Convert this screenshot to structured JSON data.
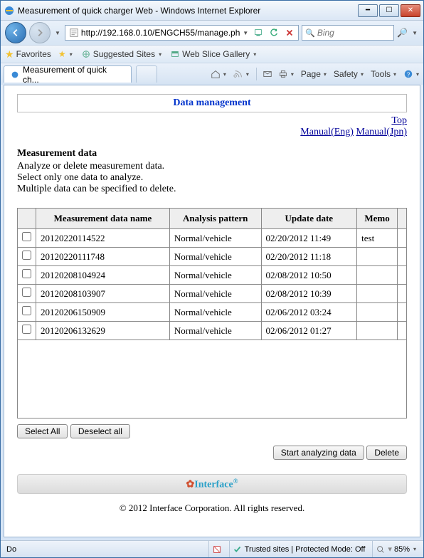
{
  "window": {
    "title": "Measurement of quick charger Web - Windows Internet Explorer"
  },
  "address": {
    "url": "http://192.168.0.10/ENGCH55/manage.ph"
  },
  "search": {
    "placeholder": "Bing"
  },
  "favorites": {
    "label": "Favorites",
    "suggested": "Suggested Sites",
    "webslice": "Web Slice Gallery"
  },
  "tab": {
    "title": "Measurement of quick ch..."
  },
  "cmd": {
    "page": "Page",
    "safety": "Safety",
    "tools": "Tools"
  },
  "page": {
    "header": "Data management",
    "link_top": "Top",
    "link_eng": "Manual(Eng)",
    "link_jpn": "Manual(Jpn)",
    "section_title": "Measurement data",
    "line1": "Analyze or delete measurement data.",
    "line2": "Select only one data to analyze.",
    "line3": "Multiple data can be specified to delete.",
    "th_name": "Measurement data name",
    "th_pattern": "Analysis pattern",
    "th_update": "Update date",
    "th_memo": "Memo",
    "rows": [
      {
        "name": "20120220114522",
        "pattern": "Normal/vehicle",
        "update": "02/20/2012 11:49",
        "memo": "test"
      },
      {
        "name": "20120220111748",
        "pattern": "Normal/vehicle",
        "update": "02/20/2012 11:18",
        "memo": ""
      },
      {
        "name": "20120208104924",
        "pattern": "Normal/vehicle",
        "update": "02/08/2012 10:50",
        "memo": ""
      },
      {
        "name": "20120208103907",
        "pattern": "Normal/vehicle",
        "update": "02/08/2012 10:39",
        "memo": ""
      },
      {
        "name": "20120206150909",
        "pattern": "Normal/vehicle",
        "update": "02/06/2012 03:24",
        "memo": ""
      },
      {
        "name": "20120206132629",
        "pattern": "Normal/vehicle",
        "update": "02/06/2012 01:27",
        "memo": ""
      }
    ],
    "btn_select_all": "Select All",
    "btn_deselect_all": "Deselect all",
    "btn_start": "Start analyzing data",
    "btn_delete": "Delete",
    "footer_logo": "Interface",
    "copyright": "© 2012 Interface Corporation. All rights reserved."
  },
  "status": {
    "done": "Do",
    "trusted": "Trusted sites | Protected Mode: Off",
    "zoom": "85%"
  }
}
